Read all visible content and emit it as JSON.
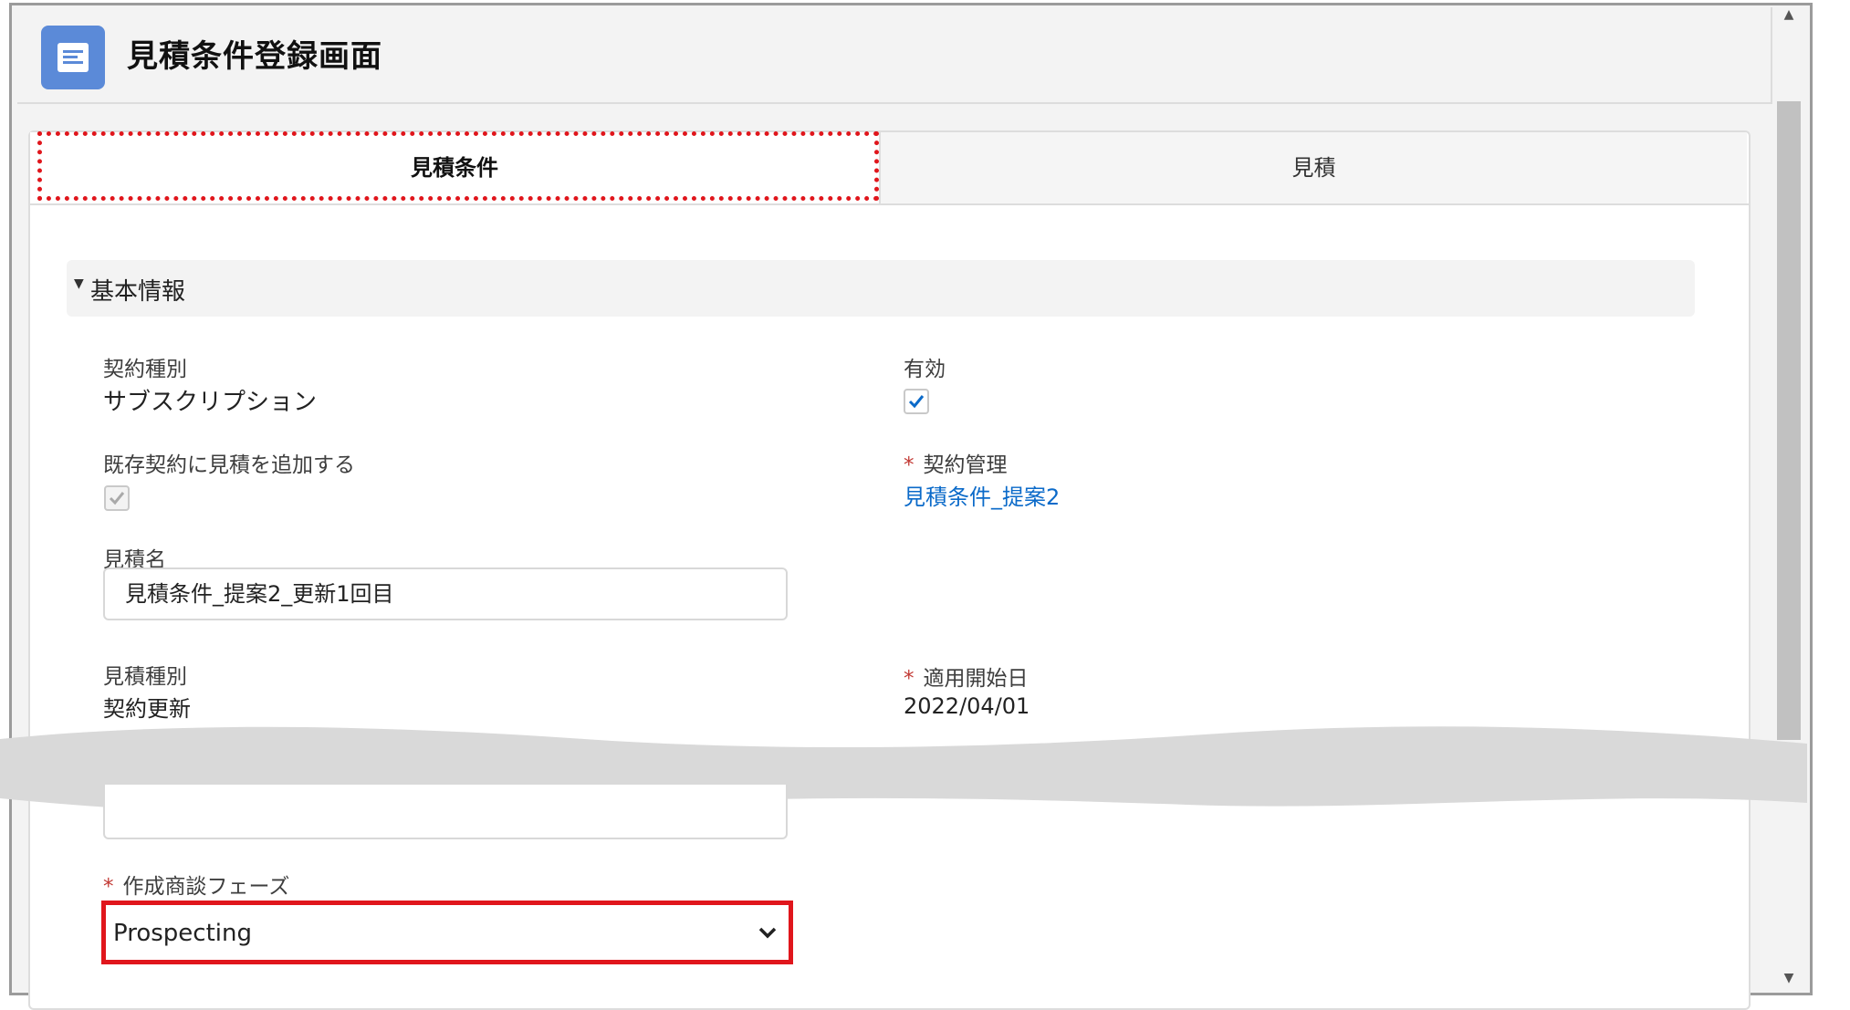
{
  "header": {
    "title": "見積条件登録画面",
    "icon": "form-icon"
  },
  "tabs": [
    {
      "label": "見積条件",
      "active": true
    },
    {
      "label": "見積",
      "active": false
    }
  ],
  "section": {
    "title": "基本情報",
    "toggle_icon": "triangle-down-icon"
  },
  "fields": {
    "contract_type": {
      "label": "契約種別",
      "value": "サブスクリプション"
    },
    "active": {
      "label": "有効",
      "checked": true
    },
    "add_to_existing": {
      "label": "既存契約に見積を追加する",
      "checked": true,
      "disabled": true
    },
    "contract_mgmt": {
      "label": "契約管理",
      "required_mark": "*",
      "value": "見積条件_提案2"
    },
    "quote_name": {
      "label": "見積名",
      "value": "見積条件_提案2_更新1回目"
    },
    "quote_type": {
      "label": "見積種別",
      "value": "契約更新"
    },
    "start_date": {
      "label": "適用開始日",
      "required_mark": "*",
      "value": "2022/04/01"
    },
    "phase": {
      "label": "作成商談フェーズ",
      "required_mark": "*",
      "value": "Prospecting"
    }
  },
  "colors": {
    "accent": "#0b6ac9",
    "highlight": "#e0161c",
    "icon_bg": "#5b8ad8"
  }
}
